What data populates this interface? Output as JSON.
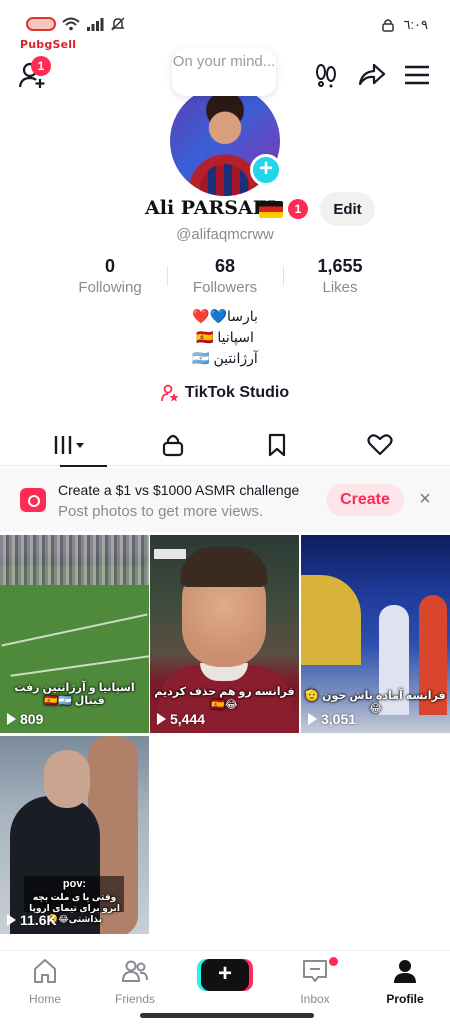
{
  "status_bar": {
    "time": "٦:٠٩",
    "brand": "PubgSell"
  },
  "note": {
    "text": "On your mind..."
  },
  "badges": {
    "add_friend_count": "1",
    "name_count": "1"
  },
  "profile": {
    "name": "Ali PARSAEI",
    "handle": "@alifaqmcrww",
    "edit_label": "Edit"
  },
  "stats": [
    {
      "value": "0",
      "label": "Following"
    },
    {
      "value": "68",
      "label": "Followers"
    },
    {
      "value": "1,655",
      "label": "Likes"
    }
  ],
  "bio": [
    "بارسا💙❤️",
    "اسپانیا 🇪🇸",
    "آرژانتین 🇦🇷"
  ],
  "studio": {
    "label": "TikTok Studio"
  },
  "banner": {
    "title": "Create a $1 vs $1000 ASMR challenge",
    "subtitle": "Post photos to get more views.",
    "button": "Create",
    "close": "×"
  },
  "videos": [
    {
      "views": "809",
      "caption": "اسپانیا و آرژانتین رفت فینال 🇪🇸🇦🇷"
    },
    {
      "views": "5,444",
      "caption": "فرانسه رو هم حذف کردیم 😂🇪🇸"
    },
    {
      "views": "3,051",
      "caption": "فرانسه آماده باش جون 🫡😂"
    },
    {
      "views": "11.6K",
      "caption_top": "pov:",
      "caption": "وقتی یا ی ملت بچه ابرو برای تیمای اروپا نذاشتی😂🫠"
    }
  ],
  "nav": {
    "home": "Home",
    "friends": "Friends",
    "create": "+",
    "inbox": "Inbox",
    "profile": "Profile"
  },
  "colors": {
    "accent": "#fe2c55",
    "cyan": "#25f4ee",
    "avatar_plus": "#20d5ec"
  }
}
